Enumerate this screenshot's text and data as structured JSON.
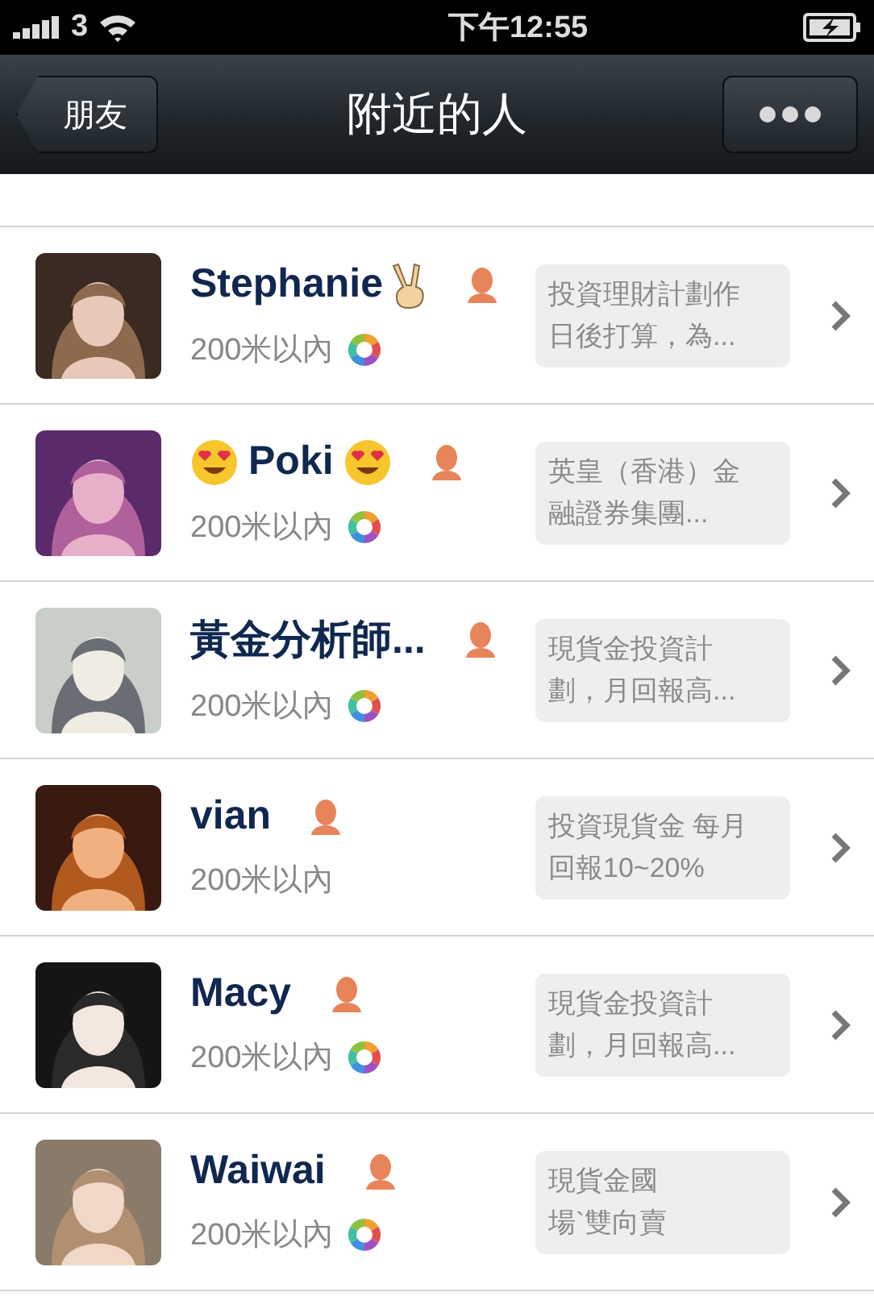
{
  "status_bar": {
    "carrier": "3",
    "time": "下午12:55"
  },
  "nav": {
    "back": "朋友",
    "title": "附近的人"
  },
  "people": [
    {
      "name_parts": [
        {
          "kind": "text",
          "text": "Stephanie"
        },
        {
          "kind": "victory_emoji"
        }
      ],
      "distance": "200米以內",
      "has_moments": true,
      "status_lines": [
        "投資理財計劃作",
        "日後打算，為..."
      ]
    },
    {
      "name_parts": [
        {
          "kind": "heart_eyes_emoji"
        },
        {
          "kind": "text",
          "text": "Poki"
        },
        {
          "kind": "heart_eyes_emoji"
        }
      ],
      "distance": "200米以內",
      "has_moments": true,
      "status_lines": [
        "英皇（香港）金",
        "融證券集團..."
      ]
    },
    {
      "name_parts": [
        {
          "kind": "text",
          "text": "黃金分析師..."
        }
      ],
      "distance": "200米以內",
      "has_moments": true,
      "status_lines": [
        "現貨金投資計",
        "劃，月回報高..."
      ]
    },
    {
      "name_parts": [
        {
          "kind": "text",
          "text": "vian"
        }
      ],
      "distance": "200米以內",
      "has_moments": false,
      "status_lines": [
        "投資現貨金 每月",
        "回報10~20%"
      ]
    },
    {
      "name_parts": [
        {
          "kind": "text",
          "text": "Macy"
        }
      ],
      "distance": "200米以內",
      "has_moments": true,
      "status_lines": [
        "現貨金投資計",
        "劃，月回報高..."
      ]
    },
    {
      "name_parts": [
        {
          "kind": "text",
          "text": "Waiwai"
        }
      ],
      "distance": "200米以內",
      "has_moments": true,
      "status_lines": [
        "現貨金國",
        "場`雙向賣"
      ]
    }
  ]
}
